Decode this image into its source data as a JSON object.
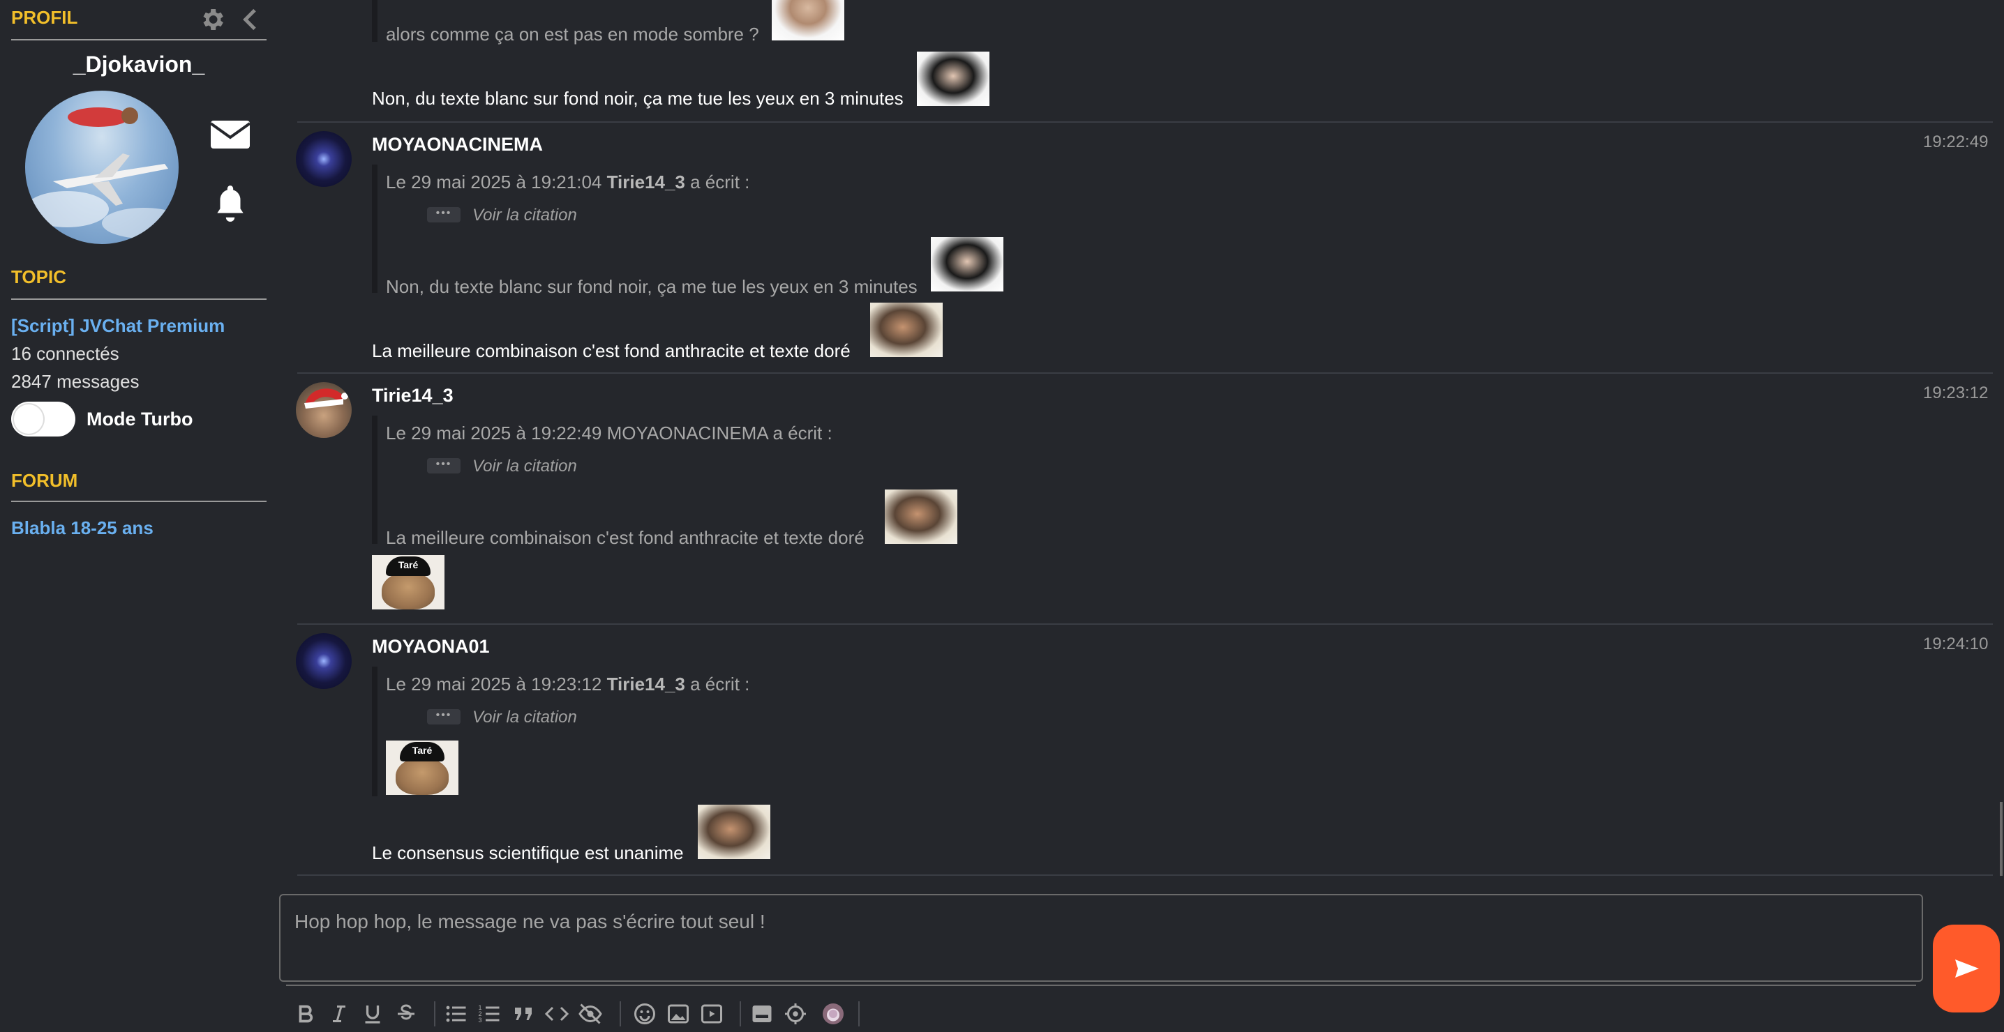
{
  "sidebar": {
    "profile_title": "PROFIL",
    "username": "_Djokavion_",
    "topic_title": "TOPIC",
    "topic_name": "[Script] JVChat Premium",
    "connected": "16 connectés",
    "messages": "2847 messages",
    "turbo_label": "Mode Turbo",
    "turbo_on": false,
    "forum_title": "FORUM",
    "forum_name": "Blabla 18-25 ans"
  },
  "messages": [
    {
      "prev_quote_text": "alors comme ça on est pas en mode sombre ?",
      "body": "Non, du texte blanc sur fond noir, ça me tue les yeux en 3 minutes"
    },
    {
      "author": "MOYAONACINEMA",
      "time": "19:22:49",
      "quote_prefix": "Le 29 mai 2025 à 19:21:04",
      "quote_author": "Tirie14_3",
      "quote_suffix": "a écrit :",
      "cite": "Voir la citation",
      "quote_text": "Non, du texte blanc sur fond noir, ça me tue les yeux en 3 minutes",
      "body": "La meilleure combinaison c'est fond anthracite et texte doré"
    },
    {
      "author": "Tirie14_3",
      "time": "19:23:12",
      "quote_head": "Le 29 mai 2025 à 19:22:49 MOYAONACINEMA a écrit :",
      "cite": "Voir la citation",
      "quote_text": "La meilleure combinaison c'est fond anthracite et texte doré"
    },
    {
      "author": "MOYAONA01",
      "time": "19:24:10",
      "quote_prefix": "Le 29 mai 2025 à 19:23:12",
      "quote_author": "Tirie14_3",
      "quote_suffix": "a écrit :",
      "cite": "Voir la citation",
      "body": "Le consensus scientifique est unanime"
    }
  ],
  "stickers": {
    "tare_label": "Taré"
  },
  "composer": {
    "placeholder": "Hop hop hop, le message ne va pas s'écrire tout seul !"
  },
  "colors": {
    "accent": "#f2bf2a",
    "link": "#6ab0f0",
    "send": "#ff5a2a",
    "background": "#25272c"
  },
  "toolbar": [
    "bold-icon",
    "italic-icon",
    "underline-icon",
    "strikethrough-icon",
    "bullet-list-icon",
    "numbered-list-icon",
    "quote-icon",
    "code-icon",
    "spoiler-icon",
    "emoji-icon",
    "image-icon",
    "video-icon",
    "sticker-icon",
    "settings-icon",
    "coffee-icon"
  ]
}
